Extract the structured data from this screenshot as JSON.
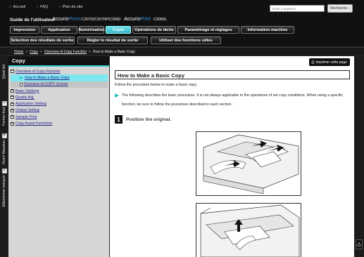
{
  "top_links": [
    "Accueil",
    "FAQ",
    "Plan du site"
  ],
  "search": {
    "placeholder": "Enter a keyword",
    "button_label": "Recherche"
  },
  "title": {
    "guide": "Guide de l'utilisateur",
    "brand1_a": "Accurio",
    "brand1_b": "Press",
    "models1": "C2070/C2070P/C2060",
    "brand2_a": "Accurio",
    "brand2_b": "Print",
    "models2": "C2060L"
  },
  "nav_row1": [
    "Impression",
    "Application",
    "Numérisation",
    "Copie",
    "Opérations de tâche",
    "Paramétrage et réglages",
    "Information machine"
  ],
  "nav_row2": [
    "Sélection des résultats de sortie",
    "Régler le résultat de sortie",
    "Utiliser des fonctions utiles"
  ],
  "breadcrumb": [
    "Home",
    "Copy",
    "Overview of Copy Function",
    "How to Make a Basic Copy"
  ],
  "rail_tabs": [
    "Quick list",
    "Fermer tout",
    "Ouvrir Nouveau",
    "Sélectionne marquer"
  ],
  "sidebar": {
    "heading": "Copy",
    "items": [
      {
        "label": "Overview of Copy Function",
        "open": true
      },
      {
        "label": "How to Make a Basic Copy"
      },
      {
        "label": "Overview of COPY Screen"
      },
      {
        "label": "Basic Settings"
      },
      {
        "label": "Quality Adj."
      },
      {
        "label": "Application Setting"
      },
      {
        "label": "Output Setting"
      },
      {
        "label": "Sample Print"
      },
      {
        "label": "Copy Assist Functions"
      }
    ]
  },
  "main": {
    "print_label": "Imprimer cette page",
    "heading": "How to Make a Basic Copy",
    "intro": "Follow the procedure below to make a basic copy.",
    "note": "The following describes the basic procedure. It is not always applicable to the operations of set copy conditions. When using a specific function, be sure to follow the procedure described in each section.",
    "step_number": "1",
    "step_text": "Position the original."
  },
  "top_button": "TOP",
  "colors": {
    "accent": "#35b7c9",
    "link": "#23238a",
    "brand_blue": "#3a8fd8"
  }
}
